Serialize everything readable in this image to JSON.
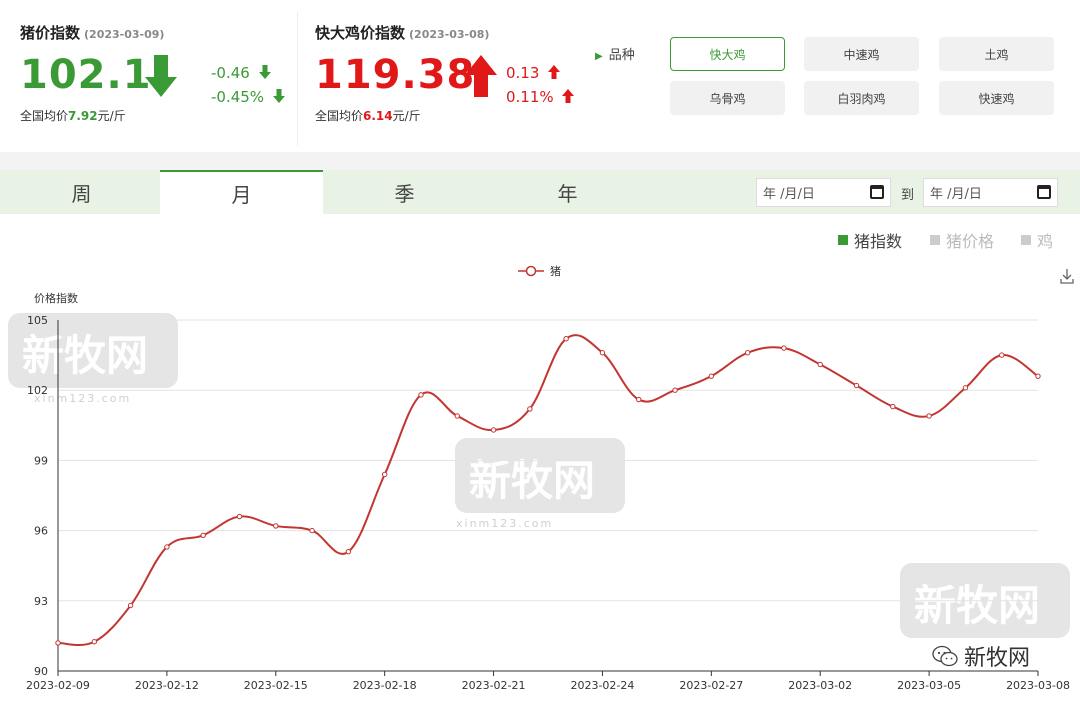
{
  "pig_panel": {
    "title": "猪价指数",
    "date": "(2023-03-09)",
    "value": "102.1",
    "change_abs": "-0.46",
    "change_pct": "-0.45%",
    "avg_prefix": "全国均价",
    "avg_value": "7.92",
    "avg_unit": "元/斤"
  },
  "chicken_panel": {
    "title": "快大鸡价指数",
    "date": "(2023-03-08)",
    "value": "119.38",
    "change_abs": "0.13",
    "change_pct": "0.11%",
    "avg_prefix": "全国均价",
    "avg_value": "6.14",
    "avg_unit": "元/斤"
  },
  "variety_label": "品种",
  "varieties": [
    "快大鸡",
    "中速鸡",
    "土鸡",
    "乌骨鸡",
    "白羽肉鸡",
    "快速鸡"
  ],
  "active_variety": "快大鸡",
  "tabs": [
    "周",
    "月",
    "季",
    "年"
  ],
  "active_tab": "月",
  "date_range": {
    "from_placeholder": "年 /月/日",
    "to_label": "到",
    "to_placeholder": "年 /月/日"
  },
  "series_toggles": [
    {
      "label": "猪指数",
      "color": "#3a9a35",
      "active": true
    },
    {
      "label": "猪价格",
      "color": "#cccccc",
      "active": false
    },
    {
      "label": "鸡",
      "color": "#cccccc",
      "active": false
    }
  ],
  "watermarks": {
    "brand": "新牧网",
    "site": "xinm123.com",
    "wechat": "新牧网"
  },
  "colors": {
    "accent_green": "#3a9a35",
    "down_red": "#e01818",
    "line": "#c23531"
  },
  "chart_data": {
    "type": "line",
    "ylabel": "价格指数",
    "ylim": [
      90,
      105
    ],
    "yticks": [
      90,
      93,
      96,
      99,
      102,
      105
    ],
    "x_tick_labels": [
      "2023-02-09",
      "2023-02-12",
      "2023-02-15",
      "2023-02-18",
      "2023-02-21",
      "2023-02-24",
      "2023-02-27",
      "2023-03-02",
      "2023-03-05",
      "2023-03-08"
    ],
    "legend_position": "top-center",
    "grid": true,
    "series": [
      {
        "name": "猪",
        "x": [
          "2023-02-09",
          "2023-02-10",
          "2023-02-11",
          "2023-02-12",
          "2023-02-13",
          "2023-02-14",
          "2023-02-15",
          "2023-02-16",
          "2023-02-17",
          "2023-02-18",
          "2023-02-19",
          "2023-02-20",
          "2023-02-21",
          "2023-02-22",
          "2023-02-23",
          "2023-02-24",
          "2023-02-25",
          "2023-02-26",
          "2023-02-27",
          "2023-02-28",
          "2023-03-01",
          "2023-03-02",
          "2023-03-03",
          "2023-03-04",
          "2023-03-05",
          "2023-03-06",
          "2023-03-07",
          "2023-03-08"
        ],
        "values": [
          91.2,
          91.25,
          92.8,
          95.3,
          95.8,
          96.6,
          96.2,
          96.0,
          95.1,
          98.4,
          101.8,
          100.9,
          100.3,
          101.2,
          104.2,
          103.6,
          101.6,
          102.0,
          102.6,
          103.6,
          103.8,
          103.1,
          102.2,
          101.3,
          100.9,
          102.1,
          103.5,
          102.6
        ]
      }
    ]
  }
}
